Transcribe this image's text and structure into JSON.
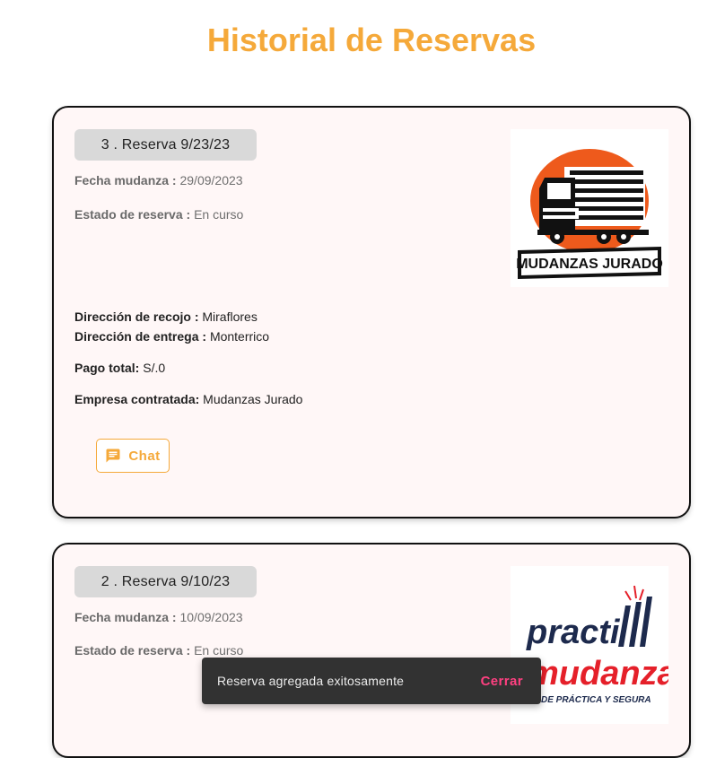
{
  "page": {
    "title": "Historial de Reservas"
  },
  "reservations": [
    {
      "chip": "3 . Reserva 9/23/23",
      "fecha_label": "Fecha mudanza :",
      "fecha_value": "29/09/2023",
      "estado_label": "Estado de reserva :",
      "estado_value": "En curso",
      "recojo_label": "Dirección de recojo :",
      "recojo_value": "Miraflores",
      "entrega_label": "Dirección de entrega :",
      "entrega_value": "Monterrico",
      "pago_label": "Pago total:",
      "pago_value": "S/.0",
      "empresa_label": "Empresa contratada:",
      "empresa_value": "Mudanzas Jurado",
      "chat_label": "Chat",
      "logo_text": "MUDANZAS JURADO"
    },
    {
      "chip": "2 . Reserva 9/10/23",
      "fecha_label": "Fecha mudanza :",
      "fecha_value": "10/09/2023",
      "estado_label": "Estado de reserva :",
      "estado_value": "En curso",
      "logo_text_top": "practi",
      "logo_text_bottom": "mudanza",
      "logo_tagline": "DE PRÁCTICA Y SEGURA"
    }
  ],
  "snackbar": {
    "message": "Reserva agregada exitosamente",
    "action": "Cerrar"
  },
  "colors": {
    "accent": "#f5a93a",
    "snack_action": "#ff4081",
    "logo_orange": "#ee5a1c",
    "logo_red": "#e5202a"
  }
}
